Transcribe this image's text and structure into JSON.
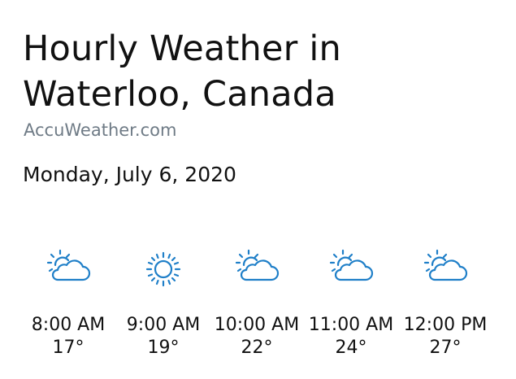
{
  "header": {
    "title": "Hourly Weather in Waterloo, Canada",
    "source": "AccuWeather.com",
    "date": "Monday, July 6, 2020"
  },
  "icon_color": "#1f7fc8",
  "hours": [
    {
      "time": "8:00 AM",
      "temp": "17°",
      "icon": "partly-sunny-icon"
    },
    {
      "time": "9:00 AM",
      "temp": "19°",
      "icon": "sunny-icon"
    },
    {
      "time": "10:00 AM",
      "temp": "22°",
      "icon": "partly-sunny-icon"
    },
    {
      "time": "11:00 AM",
      "temp": "24°",
      "icon": "partly-sunny-icon"
    },
    {
      "time": "12:00 PM",
      "temp": "27°",
      "icon": "partly-sunny-icon"
    }
  ]
}
